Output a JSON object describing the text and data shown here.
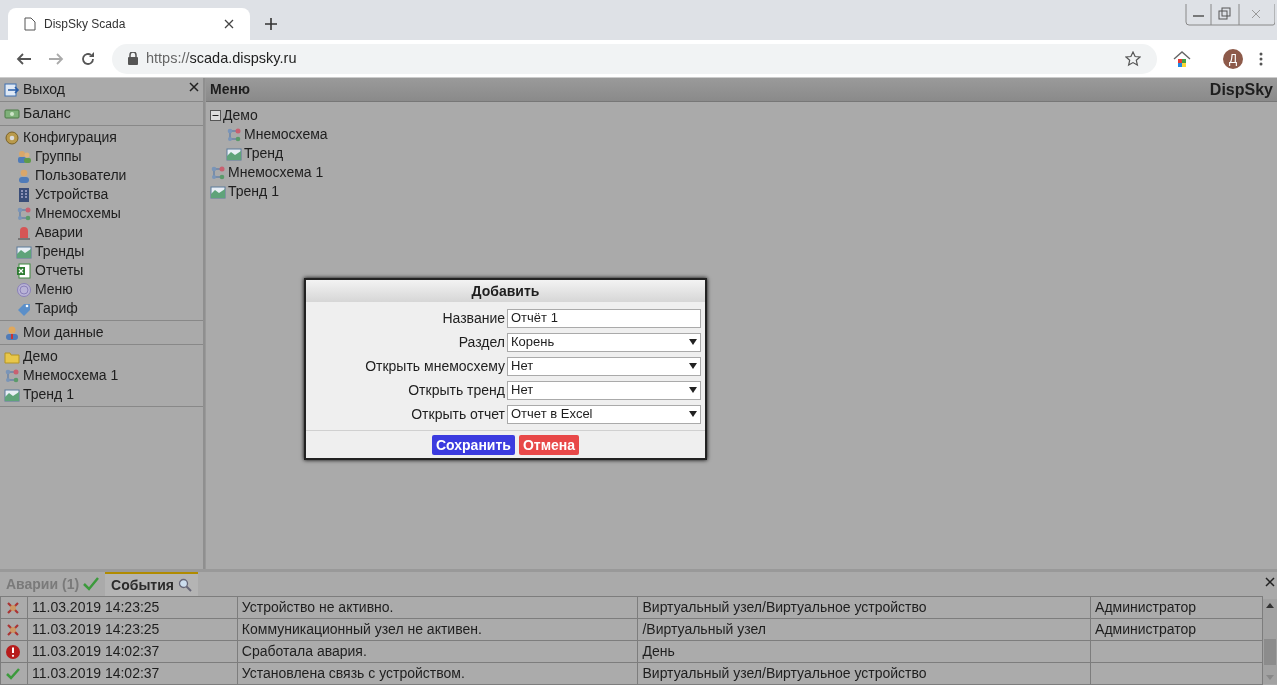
{
  "browser": {
    "tab_title": "DispSky Scada",
    "url_scheme": "https://",
    "url_host": "scada.dispsky.ru",
    "avatar": "Д"
  },
  "sidebar": {
    "sections": [
      {
        "items": [
          {
            "label": "Выход",
            "kind": "logout"
          }
        ]
      },
      {
        "items": [
          {
            "label": "Баланс",
            "kind": "balance"
          }
        ]
      },
      {
        "items": [
          {
            "label": "Конфигурация",
            "kind": "settings",
            "children": [
              {
                "label": "Группы",
                "kind": "group"
              },
              {
                "label": "Пользователи",
                "kind": "user"
              },
              {
                "label": "Устройства",
                "kind": "device"
              },
              {
                "label": "Мнемосхемы",
                "kind": "schema"
              },
              {
                "label": "Аварии",
                "kind": "alarm"
              },
              {
                "label": "Тренды",
                "kind": "trend"
              },
              {
                "label": "Отчеты",
                "kind": "report"
              },
              {
                "label": "Меню",
                "kind": "menu"
              },
              {
                "label": "Тариф",
                "kind": "tariff"
              }
            ]
          }
        ]
      },
      {
        "items": [
          {
            "label": "Мои данные",
            "kind": "profile"
          }
        ]
      },
      {
        "items": [
          {
            "label": "Демо",
            "kind": "folder"
          },
          {
            "label": "Мнемосхема 1",
            "kind": "schema"
          },
          {
            "label": "Тренд 1",
            "kind": "trend"
          }
        ]
      }
    ]
  },
  "main": {
    "title": "Меню",
    "brand": "DispSky",
    "tree": [
      {
        "label": "Демо",
        "expanded": true,
        "children": [
          {
            "label": "Мнемосхема",
            "kind": "schema"
          },
          {
            "label": "Тренд",
            "kind": "trend"
          }
        ]
      },
      {
        "label": "Мнемосхема 1",
        "kind": "schema"
      },
      {
        "label": "Тренд 1",
        "kind": "trend"
      }
    ]
  },
  "dialog": {
    "title": "Добавить",
    "fields": [
      {
        "label": "Название",
        "kind": "text",
        "value": "Отчёт 1"
      },
      {
        "label": "Раздел",
        "kind": "select",
        "value": "Корень"
      },
      {
        "label": "Открыть мнемосхему",
        "kind": "select",
        "value": "Нет"
      },
      {
        "label": "Открыть тренд",
        "kind": "select",
        "value": "Нет"
      },
      {
        "label": "Открыть отчет",
        "kind": "select",
        "value": "Отчет в Excel"
      }
    ],
    "buttons": [
      {
        "label": "Сохранить",
        "kind": "primary"
      },
      {
        "label": "Отмена",
        "kind": "danger"
      }
    ]
  },
  "events": {
    "tabs": [
      {
        "label": "Аварии (1)",
        "kind": "alarms",
        "selected": false
      },
      {
        "label": "События",
        "kind": "events",
        "selected": true
      }
    ],
    "rows": [
      {
        "kind": "inactive",
        "cells": [
          "11.03.2019 14:23:25",
          "Устройство не активно.",
          "Виртуальный узел/Виртуальное устройство",
          "Администратор"
        ]
      },
      {
        "kind": "inactive",
        "cells": [
          "11.03.2019 14:23:25",
          "Коммуникационный узел не активен.",
          "/Виртуальный узел",
          "Администратор"
        ]
      },
      {
        "kind": "alarm",
        "cells": [
          "11.03.2019 14:02:37",
          "Сработала авария.",
          "День",
          ""
        ]
      },
      {
        "kind": "ok",
        "cells": [
          "11.03.2019 14:02:37",
          "Установлена связь с устройством.",
          "Виртуальный узел/Виртуальное устройство",
          ""
        ]
      }
    ]
  }
}
